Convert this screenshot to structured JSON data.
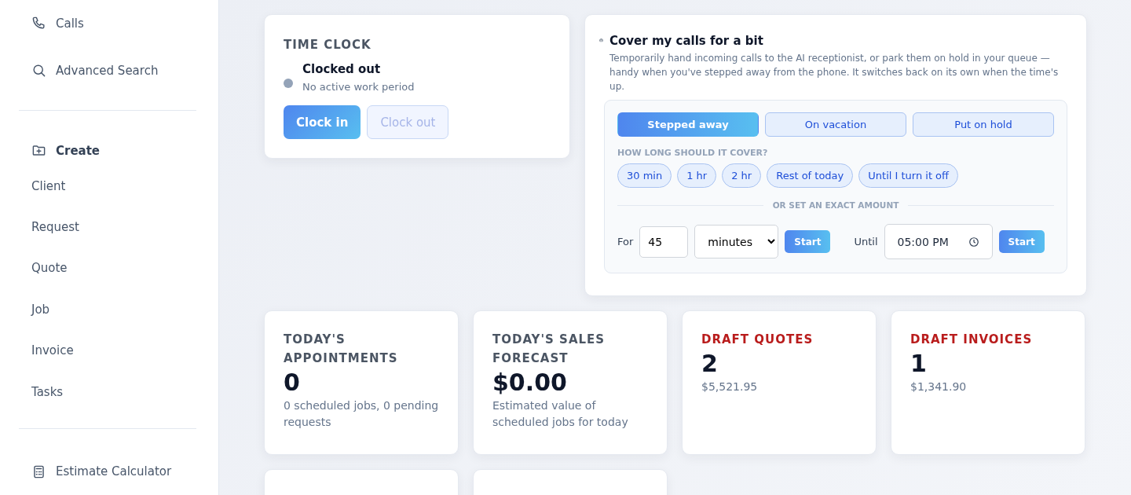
{
  "sidebar": {
    "top_items": [
      {
        "kind": "phone",
        "label": "Calls"
      },
      {
        "kind": "search",
        "label": "Advanced Search"
      }
    ],
    "create": {
      "label": "Create",
      "items": [
        "Client",
        "Request",
        "Quote",
        "Job",
        "Invoice",
        "Tasks"
      ]
    },
    "bottom_items": [
      {
        "kind": "calculator",
        "label": "Estimate Calculator"
      }
    ]
  },
  "time_clock": {
    "title": "TIME CLOCK",
    "status": "Clocked out",
    "detail": "No active work period",
    "clocked_in": false,
    "buttons": [
      {
        "label": "Clock in",
        "disabled": false
      },
      {
        "label": "Clock out",
        "disabled": true
      }
    ]
  },
  "cover": {
    "title": "Cover my calls for a bit",
    "description": "Temporarily hand incoming calls to the AI receptionist, or park them on hold in your queue — handy when you've stepped away from the phone. It switches back on its own when the time's up.",
    "modes": [
      {
        "label": "Stepped away",
        "selected": true
      },
      {
        "label": "On vacation",
        "selected": false
      },
      {
        "label": "Put on hold",
        "selected": false
      }
    ],
    "duration_label": "HOW LONG SHOULD IT COVER?",
    "durations": [
      {
        "label": "30 min",
        "selected": false
      },
      {
        "label": "1 hr",
        "selected": false
      },
      {
        "label": "2 hr",
        "selected": false
      },
      {
        "label": "Rest of today",
        "selected": false
      },
      {
        "label": "Until I turn it off",
        "selected": false
      }
    ],
    "divider_label": "OR SET AN EXACT AMOUNT",
    "for_label": "For",
    "amount": "45",
    "unit": "minutes",
    "start_label": "Start",
    "until_label": "Until",
    "until_time": "05:00 PM",
    "until_start_label": "Start"
  },
  "stats": [
    {
      "title": "TODAY'S APPOINTMENTS",
      "alert": false,
      "value": "0",
      "detail": "0 scheduled jobs, 0 pending requests"
    },
    {
      "title": "TODAY'S SALES FORECAST",
      "alert": false,
      "value": "$0.00",
      "detail": "Estimated value of scheduled jobs for today"
    },
    {
      "title": "DRAFT QUOTES",
      "alert": true,
      "value": "2",
      "detail": "$5,521.95"
    },
    {
      "title": "DRAFT INVOICES",
      "alert": true,
      "value": "1",
      "detail": "$1,341.90"
    }
  ]
}
